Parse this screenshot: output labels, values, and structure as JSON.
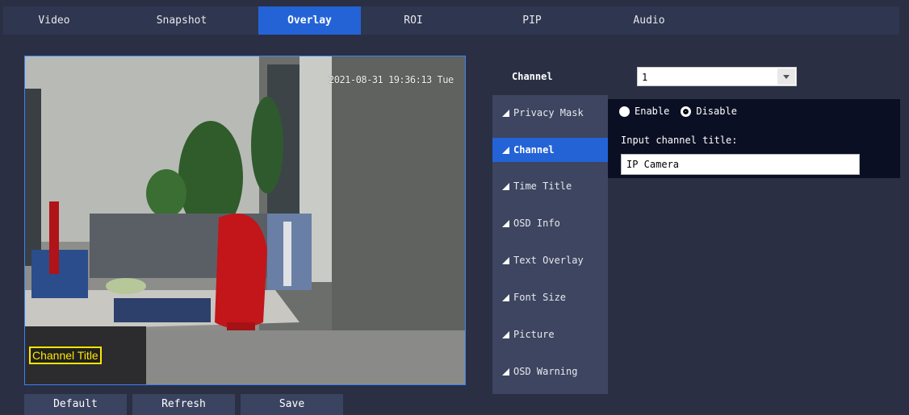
{
  "tabs": [
    {
      "label": "Video"
    },
    {
      "label": "Snapshot"
    },
    {
      "label": "Overlay"
    },
    {
      "label": "ROI"
    },
    {
      "label": "PIP"
    },
    {
      "label": "Audio"
    }
  ],
  "active_tab": "Overlay",
  "preview": {
    "timestamp": "2021-08-31 19:36:13 Tue",
    "channel_title_overlay": "Channel Title"
  },
  "buttons": {
    "default": "Default",
    "refresh": "Refresh",
    "save": "Save"
  },
  "channel": {
    "label": "Channel",
    "selected": "1"
  },
  "menu": {
    "items": [
      {
        "label": "Privacy Mask"
      },
      {
        "label": "Channel"
      },
      {
        "label": "Time Title"
      },
      {
        "label": "OSD Info"
      },
      {
        "label": "Text Overlay"
      },
      {
        "label": "Font Size"
      },
      {
        "label": "Picture"
      },
      {
        "label": "OSD Warning"
      }
    ],
    "active": "Channel"
  },
  "panel": {
    "enable_label": "Enable",
    "disable_label": "Disable",
    "selected_option": "Disable",
    "input_label": "Input channel title:",
    "input_value": "IP Camera"
  },
  "colors": {
    "accent": "#2463d6",
    "background": "#2a2f44",
    "overlay_title": "#ffe600"
  }
}
